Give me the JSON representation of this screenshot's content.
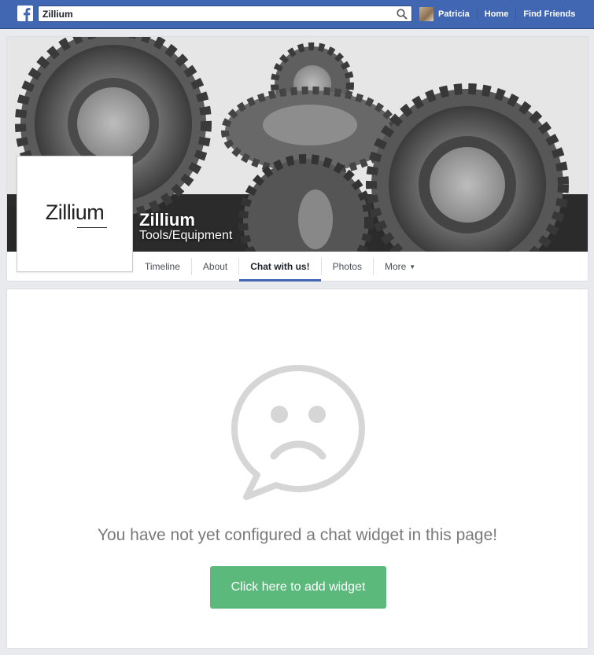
{
  "header": {
    "search_value": "Zillium",
    "user_name": "Patricia",
    "home_label": "Home",
    "find_friends_label": "Find Friends",
    "brand_color": "#4267b2"
  },
  "page": {
    "name": "Zillium",
    "category": "Tools/Equipment",
    "logo_text": "Zillium"
  },
  "tabs": [
    {
      "label": "Timeline",
      "active": false
    },
    {
      "label": "About",
      "active": false
    },
    {
      "label": "Chat with us!",
      "active": true
    },
    {
      "label": "Photos",
      "active": false
    },
    {
      "label": "More",
      "active": false
    }
  ],
  "main": {
    "empty_message": "You have not yet configured a chat widget in this page!",
    "button_label": "Click here to add widget",
    "button_color": "#5bb97b",
    "icon": "sad-chat-bubble-icon"
  }
}
